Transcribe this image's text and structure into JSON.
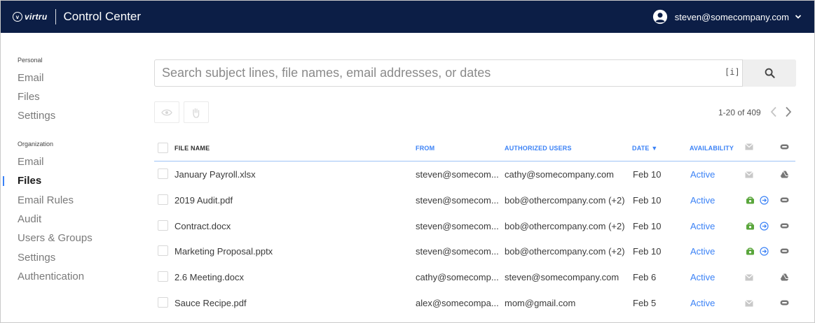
{
  "header": {
    "brand_logo": "virtru",
    "app_title": "Control Center",
    "user_email": "steven@somecompany.com"
  },
  "sidebar": {
    "personal_label": "Personal",
    "personal_items": [
      {
        "label": "Email"
      },
      {
        "label": "Files"
      },
      {
        "label": "Settings"
      }
    ],
    "org_label": "Organization",
    "org_items": [
      {
        "label": "Email"
      },
      {
        "label": "Files",
        "active": true
      },
      {
        "label": "Email Rules"
      },
      {
        "label": "Audit"
      },
      {
        "label": "Users & Groups"
      },
      {
        "label": "Settings"
      },
      {
        "label": "Authentication"
      }
    ]
  },
  "search": {
    "placeholder": "Search subject lines, file names, email addresses, or dates",
    "value": "",
    "hint": "[i]"
  },
  "pagination": {
    "text": "1-20 of 409"
  },
  "table": {
    "columns": {
      "file_name": "FILE NAME",
      "from": "FROM",
      "authorized_users": "AUTHORIZED USERS",
      "date": "DATE ▼",
      "availability": "AVAILABILITY"
    },
    "rows": [
      {
        "file_name": "January Payroll.xlsx",
        "from": "steven@somecom...",
        "authorized": "cathy@somecompany.com",
        "date": "Feb 10",
        "availability": "Active",
        "email_icon": "envelope-icon",
        "status_icons": [],
        "type_icon": "drive-icon"
      },
      {
        "file_name": "2019 Audit.pdf",
        "from": "steven@somecom...",
        "authorized": "bob@othercompany.com (+2)",
        "date": "Feb 10",
        "availability": "Active",
        "email_icon": "",
        "status_icons": [
          "watermark-icon",
          "forward-icon"
        ],
        "type_icon": "attachment-icon"
      },
      {
        "file_name": "Contract.docx",
        "from": "steven@somecom...",
        "authorized": "bob@othercompany.com (+2)",
        "date": "Feb 10",
        "availability": "Active",
        "email_icon": "",
        "status_icons": [
          "watermark-icon",
          "forward-icon"
        ],
        "type_icon": "attachment-icon"
      },
      {
        "file_name": "Marketing Proposal.pptx",
        "from": "steven@somecom...",
        "authorized": "bob@othercompany.com (+2)",
        "date": "Feb 10",
        "availability": "Active",
        "email_icon": "",
        "status_icons": [
          "watermark-icon",
          "forward-icon"
        ],
        "type_icon": "attachment-icon"
      },
      {
        "file_name": "2.6 Meeting.docx",
        "from": "cathy@somecomp...",
        "authorized": "steven@somecompany.com",
        "date": "Feb 6",
        "availability": "Active",
        "email_icon": "envelope-icon",
        "status_icons": [],
        "type_icon": "drive-icon"
      },
      {
        "file_name": "Sauce Recipe.pdf",
        "from": "alex@somecompa...",
        "authorized": "mom@gmail.com",
        "date": "Feb 5",
        "availability": "Active",
        "email_icon": "envelope-icon",
        "status_icons": [],
        "type_icon": "attachment-icon"
      }
    ]
  },
  "colors": {
    "topbar": "#0c1e46",
    "accent_blue": "#3b82f6",
    "active_green": "#4caf50"
  }
}
